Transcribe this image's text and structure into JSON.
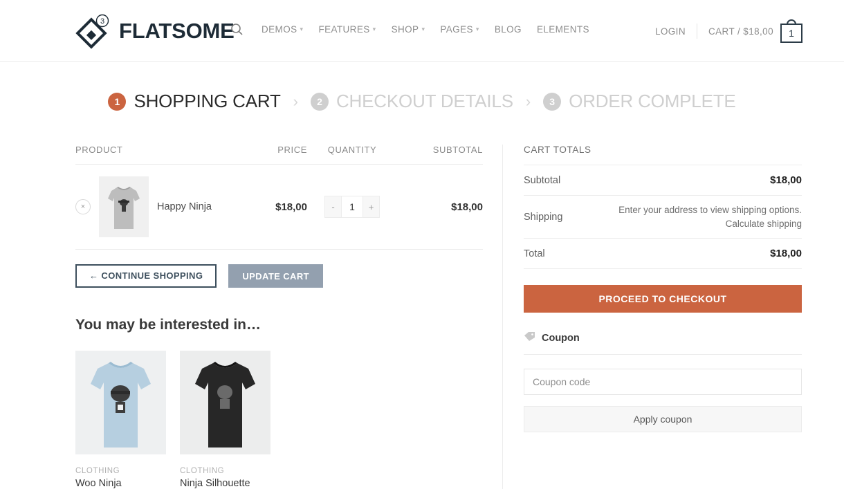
{
  "header": {
    "logo": {
      "text": "FLATSOME",
      "badge": "3",
      "icon": "flatsome-diamond-logo"
    },
    "search_icon": "search-icon",
    "nav": [
      {
        "label": "DEMOS",
        "has_dropdown": true
      },
      {
        "label": "FEATURES",
        "has_dropdown": true
      },
      {
        "label": "SHOP",
        "has_dropdown": true
      },
      {
        "label": "PAGES",
        "has_dropdown": true
      },
      {
        "label": "BLOG",
        "has_dropdown": false
      },
      {
        "label": "ELEMENTS",
        "has_dropdown": false
      }
    ],
    "login_label": "LOGIN",
    "cart_label": "CART / $18,00",
    "cart_count": "1",
    "cart_icon": "shopping-bag-icon"
  },
  "steps": [
    {
      "num": "1",
      "label": "SHOPPING CART",
      "active": true
    },
    {
      "num": "2",
      "label": "CHECKOUT DETAILS",
      "active": false
    },
    {
      "num": "3",
      "label": "ORDER COMPLETE",
      "active": false
    }
  ],
  "step_separator": "›",
  "cart_table": {
    "headers": {
      "product": "PRODUCT",
      "price": "PRICE",
      "quantity": "QUANTITY",
      "subtotal": "SUBTOTAL"
    },
    "rows": [
      {
        "remove_label": "×",
        "name": "Happy Ninja",
        "price": "$18,00",
        "qty": "1",
        "qty_minus": "-",
        "qty_plus": "+",
        "subtotal": "$18,00",
        "thumb_shirt_color": "#b9b9b9"
      }
    ]
  },
  "cart_actions": {
    "continue_label": "← CONTINUE SHOPPING",
    "update_label": "UPDATE CART"
  },
  "related": {
    "title": "You may be interested in…",
    "items": [
      {
        "category": "CLOTHING",
        "name": "Woo Ninja",
        "shirt_color": "#b6cfe0",
        "bg": "#eef0f1"
      },
      {
        "category": "CLOTHING",
        "name": "Ninja Silhouette",
        "shirt_color": "#272727",
        "bg": "#eceded"
      }
    ]
  },
  "totals": {
    "title": "CART TOTALS",
    "subtotal_label": "Subtotal",
    "subtotal_value": "$18,00",
    "shipping_label": "Shipping",
    "shipping_note": "Enter your address to view shipping options.",
    "shipping_calc": "Calculate shipping",
    "total_label": "Total",
    "total_value": "$18,00",
    "checkout_label": "PROCEED TO CHECKOUT"
  },
  "coupon": {
    "icon": "tag-icon",
    "title": "Coupon",
    "placeholder": "Coupon code",
    "value": "",
    "apply_label": "Apply coupon"
  },
  "colors": {
    "accent_orange": "#cb6440",
    "update_button": "#93a0af",
    "continue_border": "#3d4f5d",
    "inactive_grey": "#cfcfcf"
  }
}
